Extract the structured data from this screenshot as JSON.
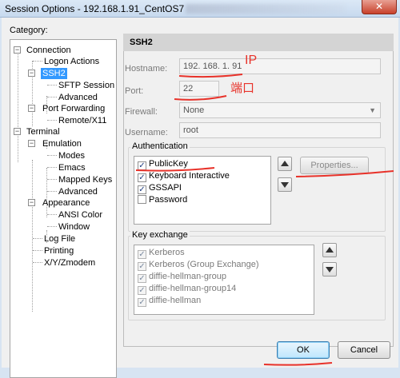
{
  "window": {
    "title": "Session Options - 192.168.1.91_CentOS7",
    "close_glyph": "✕"
  },
  "category": {
    "label": "Category:",
    "items": [
      {
        "label": "Connection"
      },
      {
        "label": "Logon Actions"
      },
      {
        "label": "SSH2"
      },
      {
        "label": "SFTP Session"
      },
      {
        "label": "Advanced"
      },
      {
        "label": "Port Forwarding"
      },
      {
        "label": "Remote/X11"
      },
      {
        "label": "Terminal"
      },
      {
        "label": "Emulation"
      },
      {
        "label": "Modes"
      },
      {
        "label": "Emacs"
      },
      {
        "label": "Mapped Keys"
      },
      {
        "label": "Advanced"
      },
      {
        "label": "Appearance"
      },
      {
        "label": "ANSI Color"
      },
      {
        "label": "Window"
      },
      {
        "label": "Log File"
      },
      {
        "label": "Printing"
      },
      {
        "label": "X/Y/Zmodem"
      }
    ]
  },
  "panel": {
    "header": "SSH2",
    "hostname": {
      "label": "Hostname:",
      "value": "192. 168. 1. 91"
    },
    "port": {
      "label": "Port:",
      "value": "22"
    },
    "firewall": {
      "label": "Firewall:",
      "value": "None"
    },
    "username": {
      "label": "Username:",
      "value": "root"
    }
  },
  "authentication": {
    "title": "Authentication",
    "items": [
      {
        "label": "PublicKey",
        "checked": true
      },
      {
        "label": "Keyboard Interactive",
        "checked": true
      },
      {
        "label": "GSSAPI",
        "checked": true
      },
      {
        "label": "Password",
        "checked": false
      }
    ],
    "properties_label": "Properties..."
  },
  "key_exchange": {
    "title": "Key exchange",
    "items": [
      {
        "label": "Kerberos",
        "checked": true
      },
      {
        "label": "Kerberos (Group Exchange)",
        "checked": true
      },
      {
        "label": "diffie-hellman-group",
        "checked": true
      },
      {
        "label": "diffie-hellman-group14",
        "checked": true
      },
      {
        "label": "diffie-hellman",
        "checked": true
      }
    ]
  },
  "buttons": {
    "ok": "OK",
    "cancel": "Cancel"
  },
  "annotations": {
    "ip": "IP",
    "port": "端口",
    "color": "#e8322a"
  },
  "icons": {
    "check": "✓",
    "expander_minus": "−"
  }
}
